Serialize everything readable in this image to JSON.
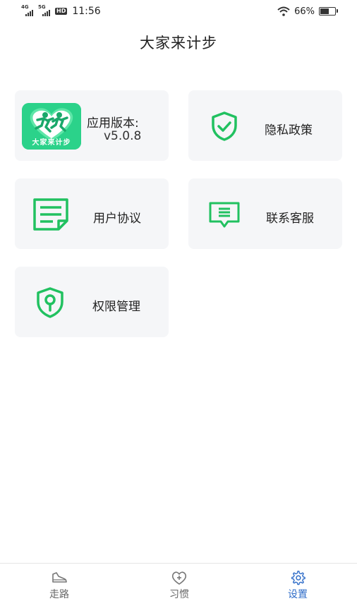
{
  "status_bar": {
    "net1": "4G",
    "net2": "5G",
    "hd": "HD",
    "time": "11:56",
    "battery_pct": "66%",
    "battery_level": 0.66
  },
  "header": {
    "title": "大家来计步"
  },
  "cards": {
    "version": {
      "label": "应用版本:",
      "value": "v5.0.8",
      "logo_text": "大家来计步"
    },
    "privacy": {
      "label": "隐私政策",
      "icon": "shield-check-icon"
    },
    "agreement": {
      "label": "用户协议",
      "icon": "document-icon"
    },
    "service": {
      "label": "联系客服",
      "icon": "chat-message-icon"
    },
    "permissions": {
      "label": "权限管理",
      "icon": "shield-key-icon"
    }
  },
  "nav": {
    "items": [
      {
        "label": "走路",
        "icon": "shoe-icon",
        "active": false
      },
      {
        "label": "习惯",
        "icon": "heart-plus-icon",
        "active": false
      },
      {
        "label": "设置",
        "icon": "gear-icon",
        "active": true
      }
    ]
  },
  "colors": {
    "accent_green": "#21c160",
    "active_blue": "#2e6cc8",
    "card_bg": "#f5f6f8"
  }
}
